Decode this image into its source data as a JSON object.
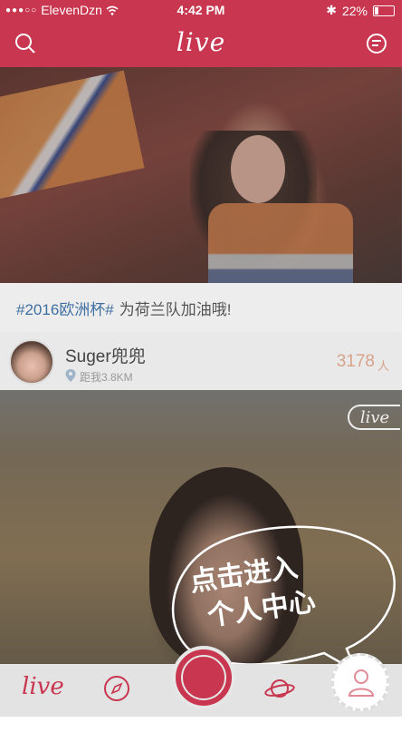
{
  "status_bar": {
    "carrier": "ElevenDzn",
    "time": "4:42 PM",
    "battery": "22%",
    "battery_level": 0.22
  },
  "header": {
    "logo": "live",
    "left_icon": "search-icon",
    "right_icon": "chat-icon"
  },
  "feed": [
    {
      "caption_tag": "#2016欧洲杯#",
      "caption_text": "为荷兰队加油哦!",
      "user_name": "Suger兜兜",
      "distance": "距我3.8KM",
      "viewer_count": "3178",
      "viewer_unit": "人"
    },
    {
      "badge": "live"
    }
  ],
  "overlay": {
    "line1": "点击进入",
    "line2": "个人中心"
  },
  "tab_bar": {
    "live_label": "live",
    "items": [
      "live",
      "discover-icon",
      "record-button",
      "planet-icon",
      "profile-icon"
    ]
  },
  "colors": {
    "brand": "#c8374f",
    "tag": "#3f6fa1",
    "count": "#d7a38a"
  }
}
